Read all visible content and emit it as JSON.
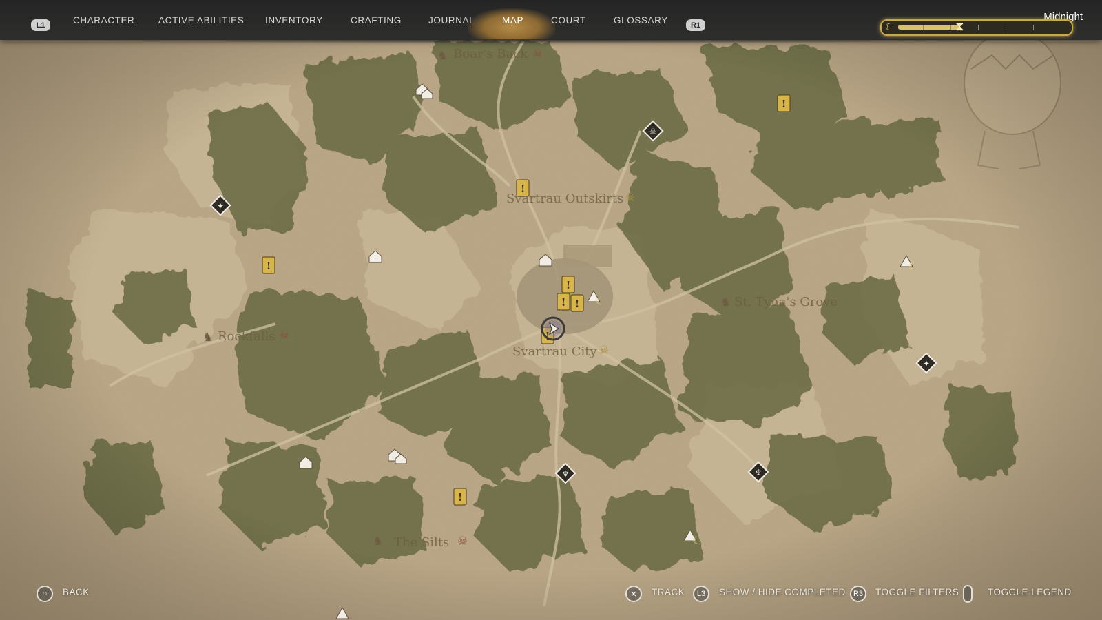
{
  "nav": {
    "left_shoulder": "L1",
    "right_shoulder": "R1",
    "tabs": [
      {
        "label": "CHARACTER"
      },
      {
        "label": "ACTIVE ABILITIES"
      },
      {
        "label": "INVENTORY"
      },
      {
        "label": "CRAFTING"
      },
      {
        "label": "JOURNAL"
      },
      {
        "label": "MAP"
      },
      {
        "label": "COURT"
      },
      {
        "label": "GLOSSARY"
      }
    ],
    "active_tab": "MAP"
  },
  "time_of_day": {
    "label": "Midnight",
    "progress": 0.36
  },
  "locations": [
    {
      "name": "Boar's Back"
    },
    {
      "name": "Svartrau Outskirts"
    },
    {
      "name": "St. Tyna's Grove"
    },
    {
      "name": "Rockfalls"
    },
    {
      "name": "Svartrau City"
    },
    {
      "name": "The Silts"
    }
  ],
  "controls": {
    "back": {
      "button": "circle",
      "label": "BACK"
    },
    "track": {
      "button": "cross",
      "label": "TRACK"
    },
    "show_hide": {
      "button": "L3",
      "label": "SHOW / HIDE COMPLETED"
    },
    "filters": {
      "button": "R3",
      "label": "TOGGLE FILTERS"
    },
    "legend": {
      "button": "touchpad",
      "label": "TOGGLE LEGEND"
    }
  },
  "colors": {
    "quest_marker": "#d7b54a",
    "forest": "#6b6d44",
    "parchment": "#b9a583",
    "accent": "#c9a84a"
  }
}
